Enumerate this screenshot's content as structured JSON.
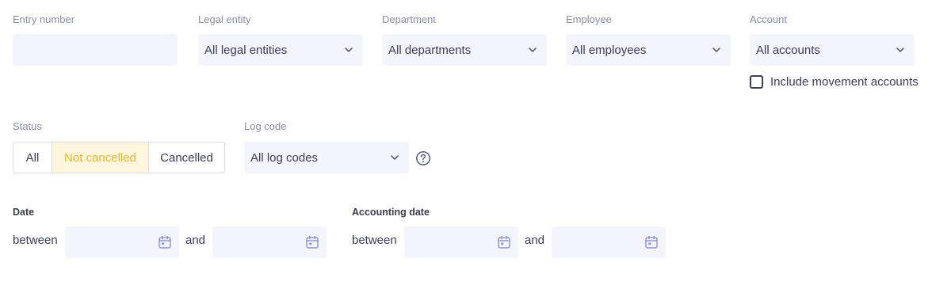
{
  "filters": {
    "entry_number": {
      "label": "Entry number",
      "value": ""
    },
    "legal_entity": {
      "label": "Legal entity",
      "value": "All legal entities"
    },
    "department": {
      "label": "Department",
      "value": "All departments"
    },
    "employee": {
      "label": "Employee",
      "value": "All employees"
    },
    "account": {
      "label": "Account",
      "value": "All accounts",
      "include_movement_label": "Include movement accounts",
      "include_movement_checked": false
    },
    "status": {
      "label": "Status",
      "options": [
        "All",
        "Not cancelled",
        "Cancelled"
      ],
      "selected": "Not cancelled"
    },
    "log_code": {
      "label": "Log code",
      "value": "All log codes"
    },
    "date": {
      "label": "Date",
      "between_label": "between",
      "and_label": "and",
      "from": "",
      "to": ""
    },
    "accounting_date": {
      "label": "Accounting date",
      "between_label": "between",
      "and_label": "and",
      "from": "",
      "to": ""
    }
  },
  "colors": {
    "field_bg": "#f4f4fd",
    "label": "#8a8ca3",
    "text": "#3b3b5a",
    "accent": "#f2b42f",
    "accent_bg": "#fff7dd",
    "icon": "#8a8fcf"
  },
  "icons": {
    "chevron": "chevron-down-icon",
    "calendar": "calendar-icon",
    "help": "help-circle-icon"
  }
}
